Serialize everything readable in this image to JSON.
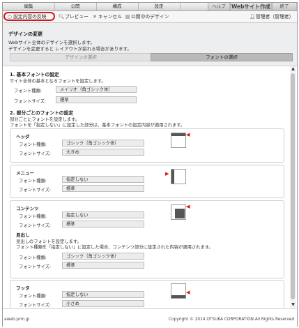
{
  "topnav": {
    "tabs": [
      "編集",
      "公開",
      "構成",
      "設定"
    ],
    "help": "ヘルプ",
    "site": "Webサイト作成",
    "exit": "終了"
  },
  "toolbar": {
    "reflect": "設定内容の反映",
    "preview": "プレビュー",
    "cancel": "キャンセル",
    "published_design": "公開中のデザイン",
    "user": "管理者（管理者）"
  },
  "header": {
    "title": "デザインの変更",
    "desc1": "Webサイト全体のデザインを選択します。",
    "desc2": "デザインを変更すると レイアウトが崩れる場合があります。",
    "seg_design": "デザインの選択",
    "seg_font": "フォントの選択"
  },
  "basic": {
    "title": "1. 基本フォントの設定",
    "desc": "サイト全体の基本となるフォントを設定します。",
    "type_label": "フォント種類:",
    "type_value": "メイリオ（角ゴシック体）",
    "size_label": "フォントサイズ:",
    "size_value": "標準"
  },
  "parts": {
    "title": "2. 部分ごとのフォントの設定",
    "desc1": "部分ごとにフォントを設定します。",
    "desc2": "フォントを「指定しない」に設定した部分は、基本フォントの設定内容が適用されます。"
  },
  "labels": {
    "type": "フォント種類:",
    "size": "フォントサイズ:"
  },
  "header_part": {
    "title": "ヘッダ",
    "type_value": "ゴシック（角ゴシック体）",
    "size_value": "大きめ"
  },
  "menu_part": {
    "title": "メニュー",
    "type_value": "指定しない",
    "size_value": "標準"
  },
  "contents_part": {
    "title": "コンテンツ",
    "type_value": "指定しない",
    "size_value": "標準",
    "heading_title": "見出し",
    "heading_desc1": "見出しのフォントを設定します。",
    "heading_desc2": "フォント種類を「指定しない」に設定した場合、コンテンツ部分に設定された内容が適用されます。",
    "heading_type_value": "ゴシック（角ゴシック体）",
    "heading_size_value": "標準"
  },
  "footer_part": {
    "title": "フッタ",
    "type_value": "指定しない",
    "size_value": "小さめ"
  },
  "footer": {
    "left": "aweb.prm.jp",
    "right": "Copyright © 2014 OTSUKA CORPORATION All Rights Reserved"
  },
  "colors": {
    "highlight": "#d21a1a",
    "arrow": "#d11111"
  }
}
